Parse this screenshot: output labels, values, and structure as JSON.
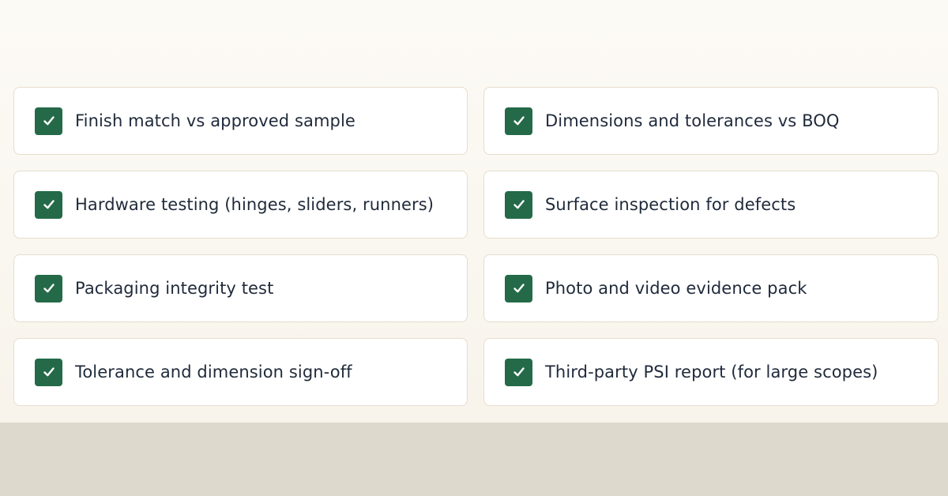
{
  "checklist": {
    "accent_color": "#246a48",
    "check_icon": "check-icon",
    "items": [
      {
        "label": "Finish match vs approved sample",
        "checked": true
      },
      {
        "label": "Dimensions and tolerances vs BOQ",
        "checked": true
      },
      {
        "label": "Hardware testing (hinges, sliders, runners)",
        "checked": true
      },
      {
        "label": "Surface inspection for defects",
        "checked": true
      },
      {
        "label": "Packaging integrity test",
        "checked": true
      },
      {
        "label": "Photo and video evidence pack",
        "checked": true
      },
      {
        "label": "Tolerance and dimension sign-off",
        "checked": true
      },
      {
        "label": "Third-party PSI report (for large scopes)",
        "checked": true
      }
    ]
  }
}
